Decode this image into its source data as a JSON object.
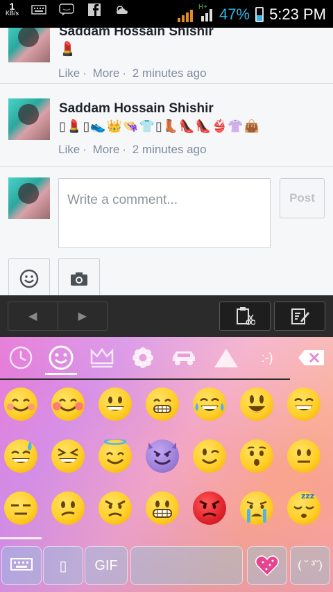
{
  "status_bar": {
    "speed_value": "1",
    "speed_unit": "KB/s",
    "network_type": "H+",
    "battery_percent": "47%",
    "battery_level": 0.47,
    "time": "5:23 PM",
    "icons": [
      "keyboard-icon",
      "messenger-icon",
      "facebook-icon",
      "weather-icon",
      "signal-icon",
      "battery-icon"
    ]
  },
  "comments": [
    {
      "author": "Saddam Hossain Shishir",
      "text": "💄",
      "actions": [
        "Like",
        "More"
      ],
      "time_ago": "2 minutes ago"
    },
    {
      "author": "Saddam Hossain Shishir",
      "text": "▯💄▯👟👑👒👕▯👢👠👠👙👚👜",
      "actions": [
        "Like",
        "More"
      ],
      "time_ago": "2 minutes ago"
    }
  ],
  "composer": {
    "placeholder": "Write a comment...",
    "post_label": "Post"
  },
  "keyboard": {
    "categories": [
      "recent-icon",
      "smiley-icon",
      "crown-icon",
      "flower-icon",
      "car-icon",
      "triangle-icon"
    ],
    "emoticon_tab": ":-)",
    "active_category": "smiley-icon",
    "emoji_grid": [
      [
        "blushing-smile",
        "blushing-grin",
        "grinning",
        "grimace-grin",
        "tears-of-joy",
        "smiley-open",
        "grinning-squint"
      ],
      [
        "sweat-smile",
        "laughing",
        "halo",
        "smiling-imp",
        "winking",
        "hushed",
        "neutral"
      ],
      [
        "expressionless",
        "confused",
        "angry",
        "grimacing",
        "pouting",
        "crying",
        "sleeping"
      ]
    ],
    "bottom_row": {
      "gif_label": "GIF",
      "unknown_key": "▯",
      "kaomoji_label": "( ˘ ³˘)"
    }
  },
  "colors": {
    "link_gray": "#7f8ca1",
    "accent_blue": "#34b5e5",
    "toolbar_bg": "#2b2b2b"
  }
}
